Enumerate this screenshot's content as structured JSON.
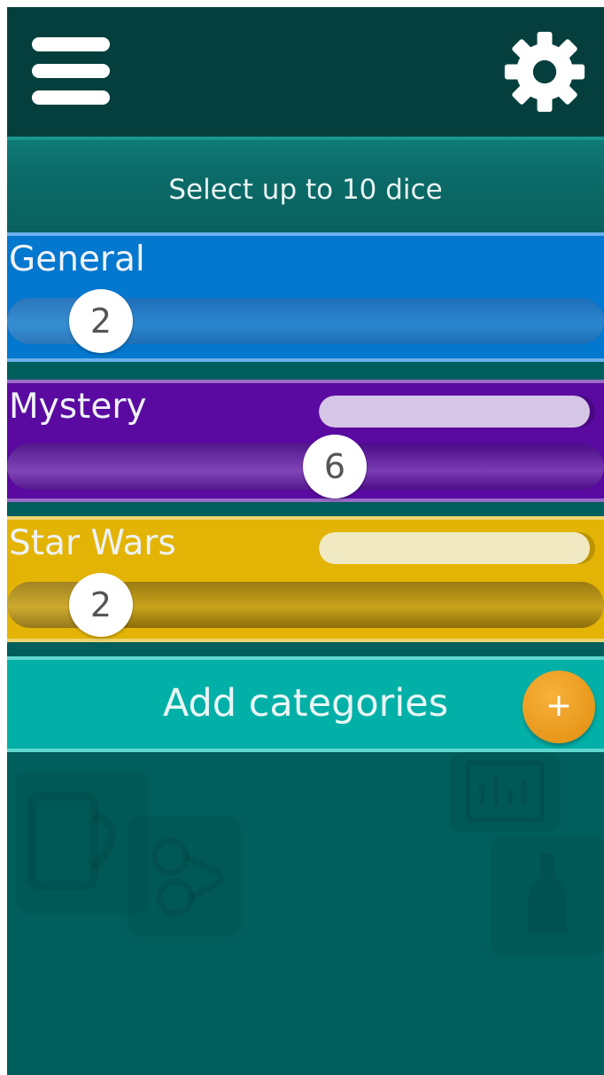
{
  "header": {
    "instruction": "Select up to 10 dice"
  },
  "categories": [
    {
      "name": "General",
      "count": "2",
      "dice_fraction": 0.2,
      "mini_bar": null
    },
    {
      "name": "Mystery",
      "count": "6",
      "dice_fraction": 0.6,
      "mini_bar": 0.98
    },
    {
      "name": "Star Wars",
      "count": "2",
      "dice_fraction": 0.2,
      "mini_bar": 0.98
    }
  ],
  "add": {
    "label": "Add categories",
    "icon_glyph": "+"
  },
  "colors": {
    "general": "#0477ce",
    "mystery": "#5a0aa0",
    "star_wars": "#e3b406",
    "add_bar": "#03b0a8",
    "add_button": "#f0a020"
  },
  "icons": {
    "menu": "hamburger-menu-icon",
    "settings": "gear-icon",
    "add": "plus-icon"
  }
}
